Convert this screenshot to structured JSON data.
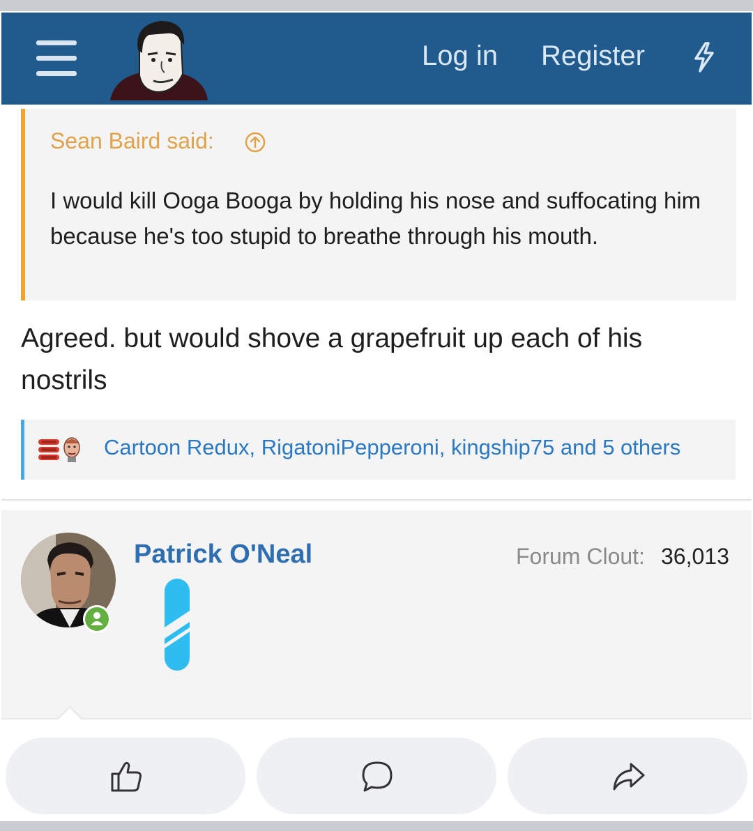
{
  "header": {
    "menu_icon": "hamburger-menu-icon",
    "logo": "site-logo-face-icon",
    "login_label": "Log in",
    "register_label": "Register",
    "whats_new_icon": "bolt-icon",
    "background_color": "#215a8c"
  },
  "quote": {
    "author_text": "Sean Baird said:",
    "jump_icon": "arrow-up-circle-icon",
    "text": "I would kill Ooga Booga by holding his nose and suffocating him because he's too stupid to breathe through his mouth.",
    "accent_color": "#f3a235"
  },
  "post": {
    "reply_text": "Agreed. but would shove a grapefruit up each of his nostrils"
  },
  "reactions": {
    "icons": [
      "hotdog-stack-icon",
      "face-reaction-icon"
    ],
    "text": "Cartoon Redux, RigatoniPepperoni, kingship75 and 5 others",
    "accent_color": "#4aa5e6"
  },
  "next_post": {
    "author_name": "Patrick O'Neal",
    "clout_label": "Forum Clout:",
    "clout_value": "36,013",
    "online_icon": "online-status-icon",
    "rank_icon": "rank-badge-icon"
  },
  "action_bar": {
    "buttons": [
      {
        "icon": "thumbs-up-icon"
      },
      {
        "icon": "comment-icon"
      },
      {
        "icon": "share-arrow-icon"
      }
    ]
  }
}
